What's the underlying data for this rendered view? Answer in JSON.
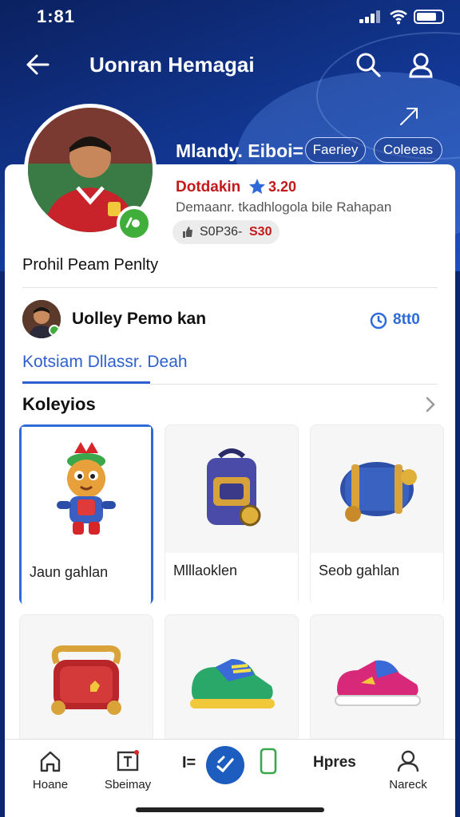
{
  "status": {
    "time": "1:81"
  },
  "header": {
    "title": "Uonran Hemagai"
  },
  "profile": {
    "name": "Mlandy. Eiboi=",
    "pills": [
      "Faeriey",
      "Coleeas"
    ],
    "rating_label": "Dotdakin",
    "rating_value": "3.20",
    "subtitle": "Demaanr. tkadhlogola bile Rahapan",
    "stat_a": "S0P36-",
    "stat_b": "S30",
    "section": "Prohil Peam Penlty"
  },
  "player": {
    "name": "Uolley Pemo kan",
    "count": "8tt0"
  },
  "tab": {
    "label": "Kotsiam Dllassr. Deah"
  },
  "collection": {
    "title": "Koleyios",
    "items": [
      {
        "label": "Jaun gahlan",
        "icon": "toy-figure-icon",
        "selected": true
      },
      {
        "label": "Mlllaoklen",
        "icon": "backpack-icon",
        "selected": false
      },
      {
        "label": "Seob gahlan",
        "icon": "barrel-icon",
        "selected": false
      },
      {
        "label": "",
        "icon": "bag-icon",
        "selected": false
      },
      {
        "label": "",
        "icon": "sneaker-icon",
        "selected": false
      },
      {
        "label": "",
        "icon": "pink-sneaker-icon",
        "selected": false
      }
    ]
  },
  "nav": {
    "home": "Hoane",
    "store": "Sbeimay",
    "sep": "I=",
    "press": "Hpres",
    "profile": "Nareck"
  },
  "colors": {
    "accent": "#2e6bd8",
    "rating": "#c4181b",
    "header": "#0d2670"
  }
}
